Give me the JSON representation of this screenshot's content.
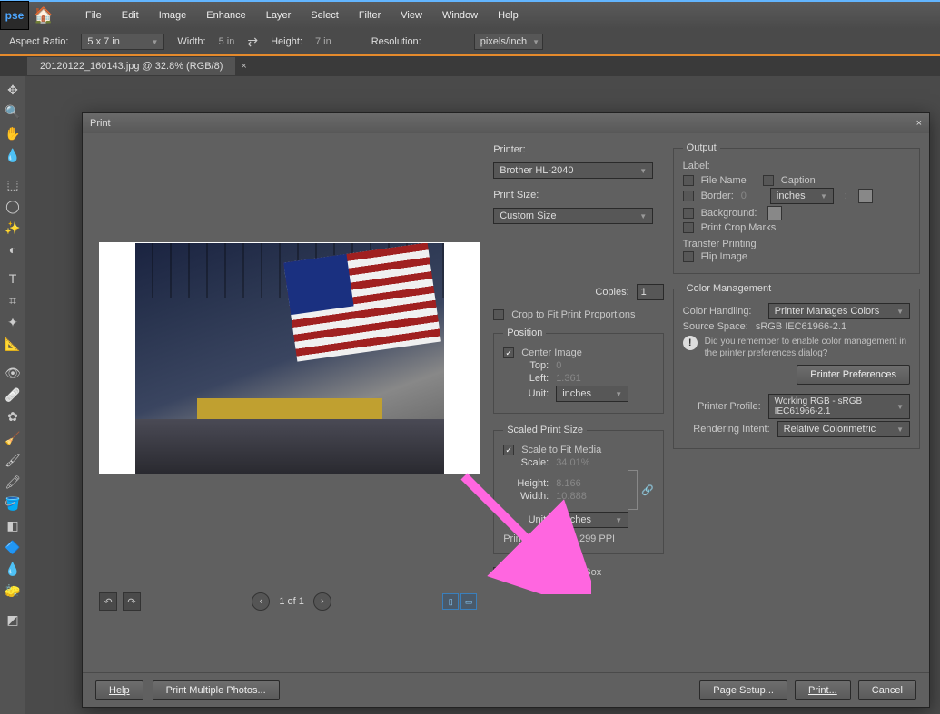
{
  "app": {
    "logo": "pse"
  },
  "menu": [
    "File",
    "Edit",
    "Image",
    "Enhance",
    "Layer",
    "Select",
    "Filter",
    "View",
    "Window",
    "Help"
  ],
  "options": {
    "aspect_label": "Aspect Ratio:",
    "aspect_value": "5 x 7 in",
    "width_label": "Width:",
    "width_value": "5 in",
    "height_label": "Height:",
    "height_value": "7 in",
    "resolution_label": "Resolution:",
    "resolution_value": "",
    "res_unit": "pixels/inch"
  },
  "doc": {
    "title": "20120122_160143.jpg @ 32.8% (RGB/8)"
  },
  "dialog": {
    "title": "Print",
    "printer_label": "Printer:",
    "printer_value": "Brother HL-2040",
    "printsize_label": "Print Size:",
    "printsize_value": "Custom Size",
    "copies_label": "Copies:",
    "copies_value": "1",
    "crop_fit": "Crop to Fit Print Proportions",
    "position": {
      "legend": "Position",
      "center": "Center Image",
      "top_label": "Top:",
      "top_value": "0",
      "left_label": "Left:",
      "left_value": "1.361",
      "unit_label": "Unit:",
      "unit_value": "inches"
    },
    "scaled": {
      "legend": "Scaled Print Size",
      "fit": "Scale to Fit Media",
      "scale_label": "Scale:",
      "scale_value": "34.01%",
      "height_label": "Height:",
      "height_value": "8.166",
      "width_label": "Width:",
      "width_value": "10.888",
      "unit_label": "Unit:",
      "unit_value": "inches",
      "res_label": "Print Resolution: 299 PPI"
    },
    "show_bbox": "Show Bounding Box",
    "output": {
      "legend": "Output",
      "label": "Label:",
      "filename": "File Name",
      "caption": "Caption",
      "border_label": "Border:",
      "border_value": "0",
      "border_unit": "inches",
      "color_swatch": "",
      "background_label": "Background:",
      "crop_marks": "Print Crop Marks",
      "transfer_label": "Transfer Printing",
      "flip": "Flip Image"
    },
    "color": {
      "legend": "Color Management",
      "handling_label": "Color Handling:",
      "handling_value": "Printer Manages Colors",
      "source_label": "Source Space:",
      "source_value": "sRGB IEC61966-2.1",
      "info": "Did you remember to enable color management in the printer preferences dialog?",
      "prefs_btn": "Printer Preferences",
      "profile_label": "Printer Profile:",
      "profile_value": "Working RGB - sRGB IEC61966-2.1",
      "intent_label": "Rendering Intent:",
      "intent_value": "Relative Colorimetric"
    },
    "pager": {
      "of": "1 of 1"
    },
    "footer": {
      "help": "Help",
      "multi": "Print Multiple Photos...",
      "page_setup": "Page Setup...",
      "print": "Print...",
      "cancel": "Cancel"
    }
  }
}
